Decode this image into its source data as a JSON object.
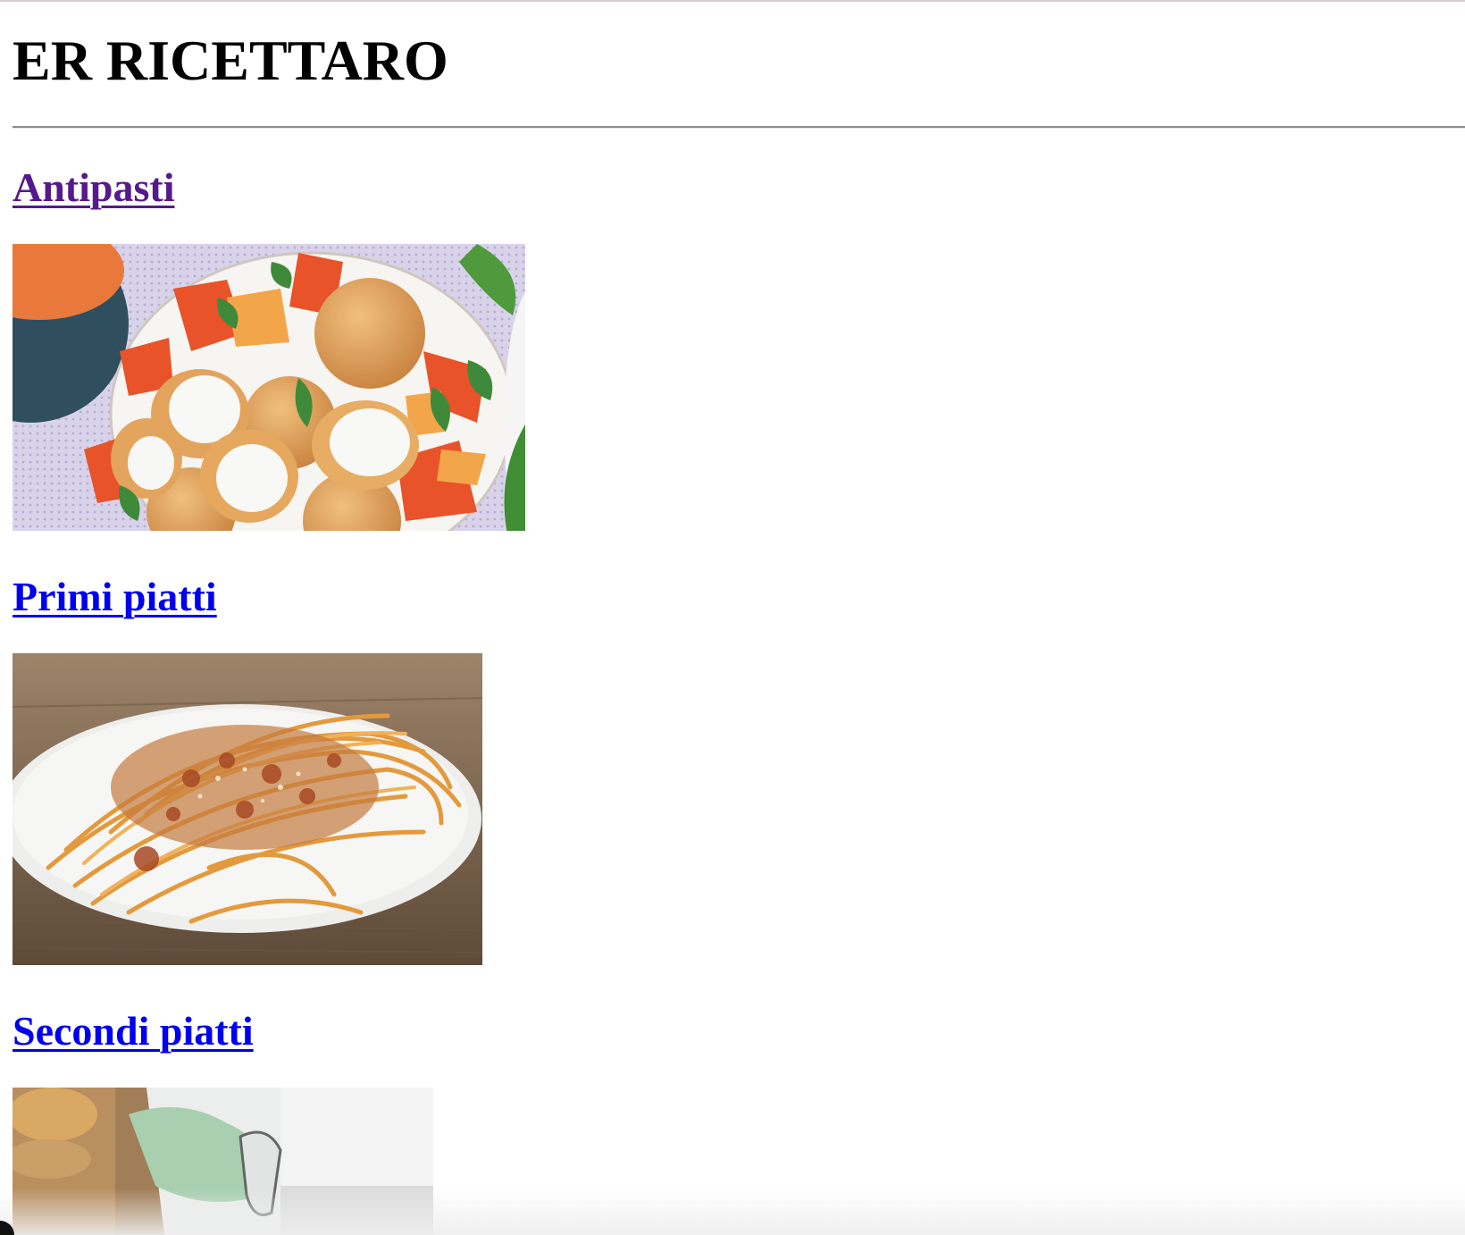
{
  "site": {
    "title": "ER RICETTARO"
  },
  "sections": [
    {
      "label": "Antipasti",
      "visited": true,
      "image": "fried-mozzarella-balls-with-peaches-and-tomatoes"
    },
    {
      "label": "Primi piatti",
      "visited": false,
      "image": "spaghetti-with-tomato-sauce-and-breadcrumbs"
    },
    {
      "label": "Secondi piatti",
      "visited": false,
      "image": "bread-in-paper-bag-with-green-cloth"
    }
  ],
  "colors": {
    "link_visited": "#551a8b",
    "link_unvisited": "#0000ee",
    "divider": "#8a8a8a"
  }
}
